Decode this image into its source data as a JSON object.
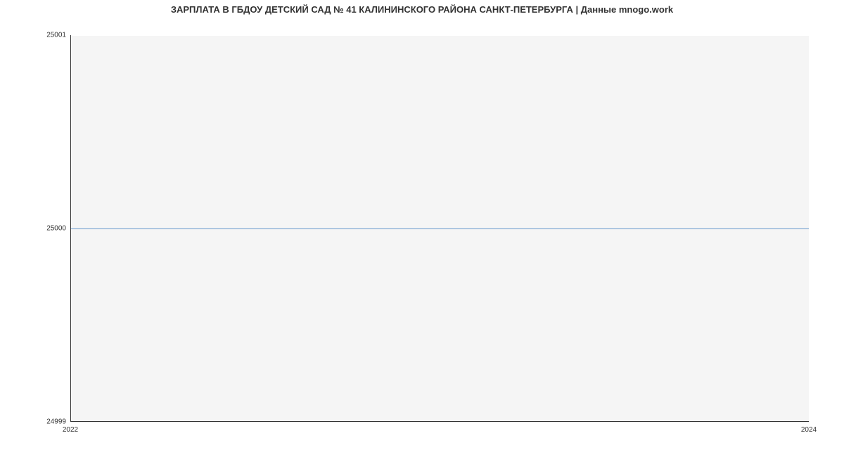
{
  "chart_data": {
    "type": "line",
    "title": "ЗАРПЛАТА В ГБДОУ ДЕТСКИЙ САД № 41 КАЛИНИНСКОГО РАЙОНА САНКТ-ПЕТЕРБУРГА | Данные mnogo.work",
    "xlabel": "",
    "ylabel": "",
    "x": [
      2022,
      2024
    ],
    "series": [
      {
        "name": "salary",
        "values": [
          25000,
          25000
        ],
        "color": "#6699cc"
      }
    ],
    "xlim": [
      2022,
      2024
    ],
    "ylim": [
      24999,
      25001
    ],
    "x_ticks": [
      2022,
      2024
    ],
    "y_ticks": [
      24999,
      25000,
      25001
    ],
    "grid": true
  }
}
